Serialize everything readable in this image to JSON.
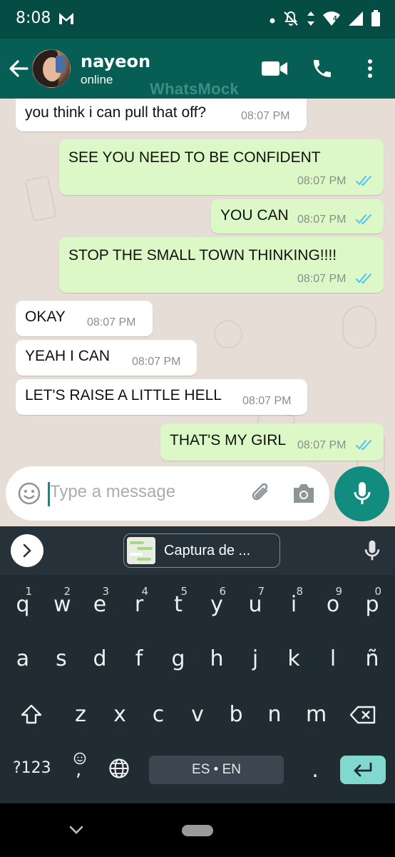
{
  "status_bar": {
    "time": "8:08",
    "network_badge": "4"
  },
  "header": {
    "contact_name": "nayeon",
    "contact_status": "online",
    "watermark": "WhatsMock"
  },
  "messages": [
    {
      "dir": "in",
      "text": "you think i can pull that off?",
      "time": "08:07 PM",
      "ticks": false
    },
    {
      "dir": "out",
      "text": "SEE YOU NEED TO BE CONFIDENT",
      "time": "08:07 PM",
      "ticks": true
    },
    {
      "dir": "out",
      "text": "YOU CAN",
      "time": "08:07 PM",
      "ticks": true
    },
    {
      "dir": "out",
      "text": "STOP THE SMALL TOWN THINKING!!!!",
      "time": "08:07 PM",
      "ticks": true
    },
    {
      "dir": "in",
      "text": "OKAY",
      "time": "08:07 PM",
      "ticks": false
    },
    {
      "dir": "in",
      "text": "YEAH I CAN",
      "time": "08:07 PM",
      "ticks": false
    },
    {
      "dir": "in",
      "text": "LET'S RAISE A LITTLE HELL",
      "time": "08:07 PM",
      "ticks": false
    },
    {
      "dir": "out",
      "text": "THAT'S MY GIRL",
      "time": "08:07 PM",
      "ticks": true
    }
  ],
  "composer": {
    "placeholder": "Type a message"
  },
  "keyboard": {
    "clipboard_chip": "Captura de ...",
    "row1": [
      {
        "k": "q",
        "n": "1"
      },
      {
        "k": "w",
        "n": "2"
      },
      {
        "k": "e",
        "n": "3"
      },
      {
        "k": "r",
        "n": "4"
      },
      {
        "k": "t",
        "n": "5"
      },
      {
        "k": "y",
        "n": "6"
      },
      {
        "k": "u",
        "n": "7"
      },
      {
        "k": "i",
        "n": "8"
      },
      {
        "k": "o",
        "n": "9"
      },
      {
        "k": "p",
        "n": "0"
      }
    ],
    "row2": [
      "a",
      "s",
      "d",
      "f",
      "g",
      "h",
      "j",
      "k",
      "l",
      "ñ"
    ],
    "row3": [
      "z",
      "x",
      "c",
      "v",
      "b",
      "n",
      "m"
    ],
    "symbols_key": "?123",
    "comma_key": ",",
    "space_label": "ES • EN",
    "period_key": "."
  },
  "colors": {
    "header": "#075e54",
    "status_bar": "#054d44",
    "outgoing_bubble": "#dcf8c6",
    "incoming_bubble": "#ffffff",
    "accent": "#128c7e",
    "read_ticks": "#4fc3f7"
  }
}
